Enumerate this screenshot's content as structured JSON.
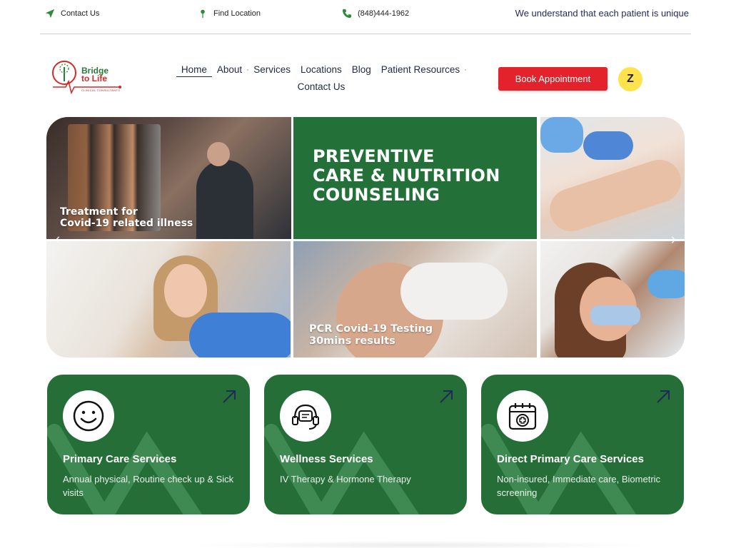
{
  "topbar": {
    "contact": "Contact Us",
    "location": "Find Location",
    "phone": "(848)444-1962",
    "tagline": "We understand that each patient is unique"
  },
  "logo": {
    "line1": "Bridge",
    "line2": "to Life",
    "subtitle": "CLINICAL CONSULTANTS"
  },
  "nav": {
    "items": [
      "Home",
      "About",
      "Services",
      "Locations",
      "Blog",
      "Patient Resources"
    ],
    "second_row": "Contact Us"
  },
  "header": {
    "book_button": "Book Appointment",
    "zocdoc_symbol": "Z"
  },
  "hero": {
    "tile1_caption_1": "Treatment for",
    "tile1_caption_2": "Covid-19 related illness",
    "headline_1": "PREVENTIVE",
    "headline_2": "CARE & NUTRITION",
    "headline_3": "COUNSELING",
    "tile5_caption_1": "PCR Covid-19 Testing",
    "tile5_caption_2": "30mins results",
    "arrow_left": "‹",
    "arrow_right": "›"
  },
  "cards": [
    {
      "icon": "smiley-face-icon",
      "title": "Primary Care Services",
      "desc": "Annual physical, Routine check up & Sick visits"
    },
    {
      "icon": "headset-chat-icon",
      "title": "Wellness Services",
      "desc": "IV Therapy & Hormone Therapy"
    },
    {
      "icon": "calendar-medical-icon",
      "title": "Direct Primary Care Services",
      "desc": "Non-insured, Immediate care, Biometric screening"
    }
  ],
  "colors": {
    "brand_green": "#256e37",
    "accent_red": "#e3222b",
    "zocdoc_yellow": "#ffe34d"
  }
}
